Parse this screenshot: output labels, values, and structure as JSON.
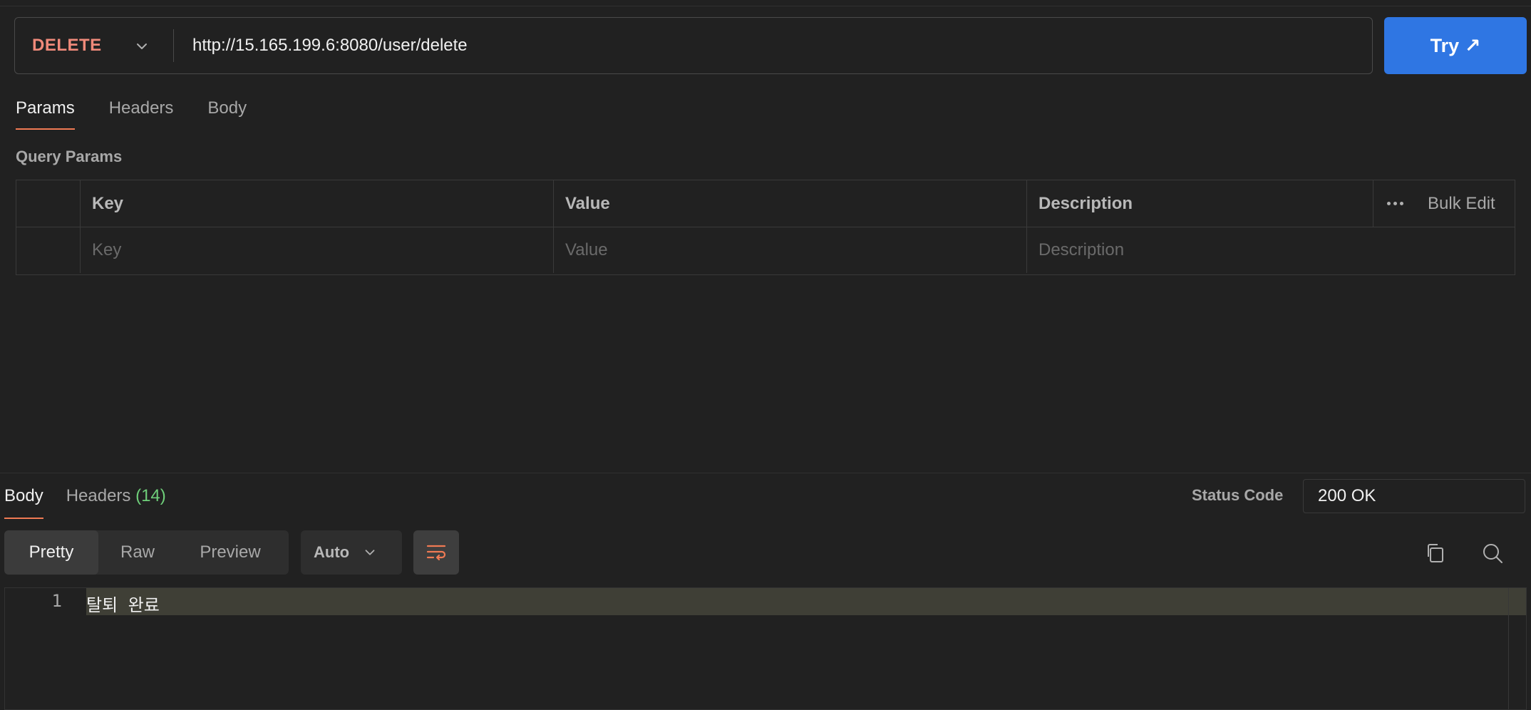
{
  "request": {
    "method": "DELETE",
    "url": "http://15.165.199.6:8080/user/delete",
    "send_label": "Try ↗"
  },
  "request_tabs": [
    {
      "label": "Params",
      "active": true
    },
    {
      "label": "Headers",
      "active": false
    },
    {
      "label": "Body",
      "active": false
    }
  ],
  "query_params": {
    "title": "Query Params",
    "headers": {
      "key": "Key",
      "value": "Value",
      "description": "Description"
    },
    "bulk_edit_label": "Bulk Edit",
    "placeholders": {
      "key": "Key",
      "value": "Value",
      "description": "Description"
    }
  },
  "response": {
    "tabs": {
      "body": "Body",
      "headers": "Headers",
      "headers_count": "(14)"
    },
    "status_label": "Status Code",
    "status_value": "200 OK",
    "views": {
      "pretty": "Pretty",
      "raw": "Raw",
      "preview": "Preview"
    },
    "format": "Auto",
    "lines": [
      {
        "number": "1",
        "text": "탈퇴 완료"
      }
    ]
  },
  "colors": {
    "accent": "#f07a54",
    "method": "#f08a7a",
    "primary_button": "#2f76e3",
    "count": "#6fcf7a",
    "background": "#212121"
  },
  "icons": [
    "chevron-down-icon",
    "more-horizontal-icon",
    "chevron-down-icon",
    "wrap-lines-icon",
    "copy-icon",
    "search-icon"
  ]
}
